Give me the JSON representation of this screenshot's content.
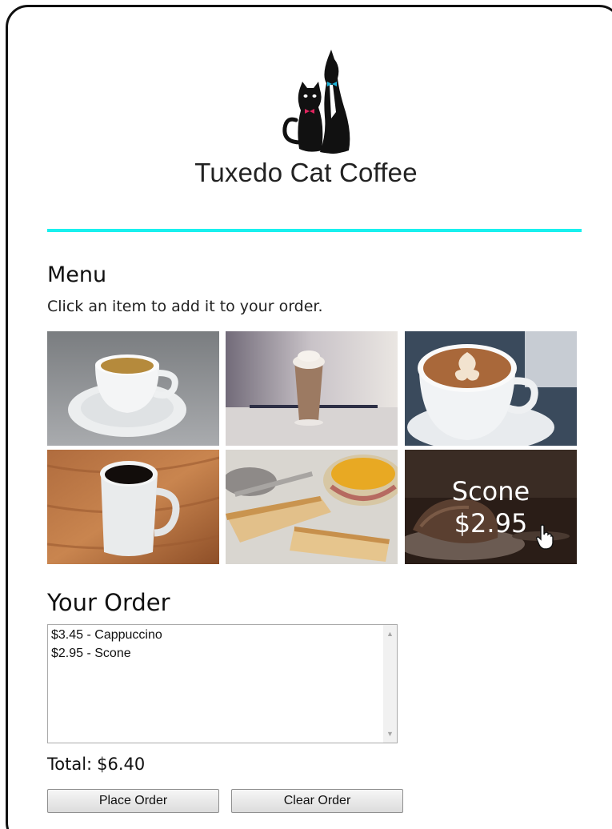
{
  "brand": {
    "name": "Tuxedo Cat Coffee",
    "accent": "#19f0ee"
  },
  "menu": {
    "title": "Menu",
    "subtitle": "Click an item to add it to your order.",
    "items": [
      {
        "image": "espresso-photo"
      },
      {
        "image": "hot-chocolate-photo"
      },
      {
        "image": "cappuccino-latte-art-photo"
      },
      {
        "image": "black-coffee-mug-photo"
      },
      {
        "image": "biscotti-and-tea-photo"
      },
      {
        "image": "scone-photo",
        "hover_name": "Scone",
        "hover_price": "$2.95"
      }
    ]
  },
  "order": {
    "title": "Your Order",
    "items": [
      "$3.45 - Cappuccino",
      "$2.95 - Scone"
    ],
    "total_label": "Total:",
    "total_value": "$6.40",
    "place_button": "Place Order",
    "clear_button": "Clear Order"
  }
}
